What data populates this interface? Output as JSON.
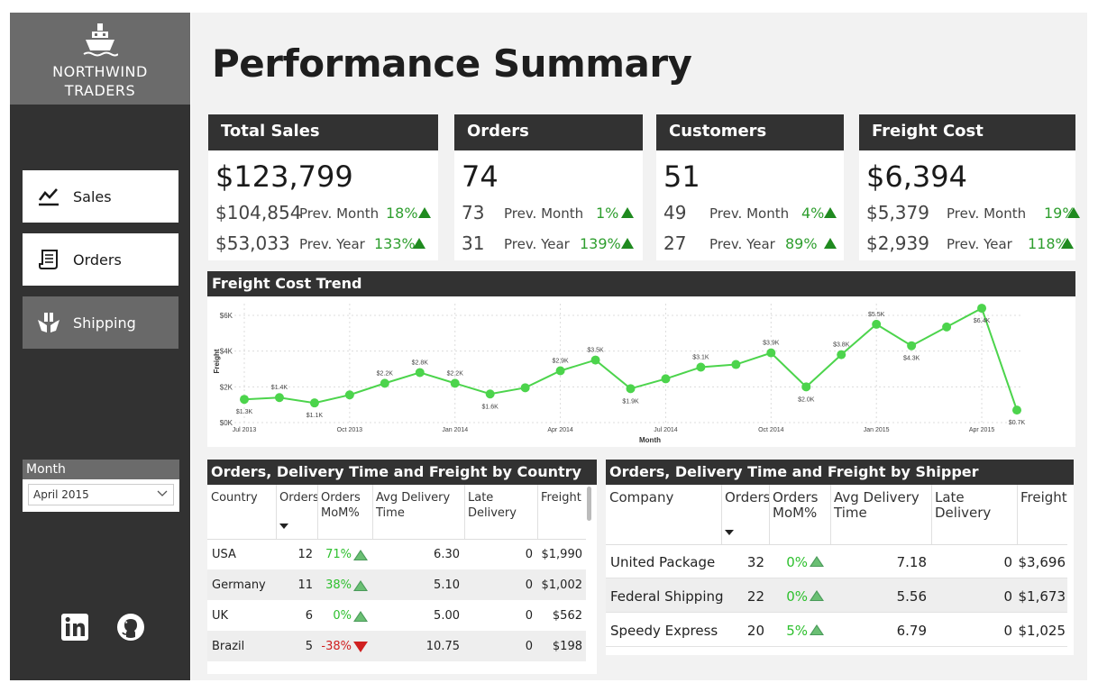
{
  "brand": {
    "line1": "NORTHWIND",
    "line2": "TRADERS"
  },
  "nav": [
    {
      "label": "Sales",
      "icon": "line-chart-icon",
      "active": false
    },
    {
      "label": "Orders",
      "icon": "receipt-icon",
      "active": false
    },
    {
      "label": "Shipping",
      "icon": "box-hands-icon",
      "active": true
    }
  ],
  "month_slicer": {
    "label": "Month",
    "selected": "April 2015"
  },
  "social": [
    {
      "icon": "linkedin-icon"
    },
    {
      "icon": "github-icon"
    }
  ],
  "page_title": "Performance Summary",
  "kpis": [
    {
      "title": "Total Sales",
      "value": "$123,799",
      "prev_month_value": "$104,854",
      "prev_month_label": "Prev. Month",
      "prev_month_pct": "18%",
      "prev_year_value": "$53,033",
      "prev_year_label": "Prev. Year",
      "prev_year_pct": "133%"
    },
    {
      "title": "Orders",
      "value": "74",
      "prev_month_value": "73",
      "prev_month_label": "Prev. Month",
      "prev_month_pct": "1%",
      "prev_year_value": "31",
      "prev_year_label": "Prev. Year",
      "prev_year_pct": "139%"
    },
    {
      "title": "Customers",
      "value": "51",
      "prev_month_value": "49",
      "prev_month_label": "Prev. Month",
      "prev_month_pct": "4%",
      "prev_year_value": "27",
      "prev_year_label": "Prev. Year",
      "prev_year_pct": "89%"
    },
    {
      "title": "Freight Cost",
      "value": "$6,394",
      "prev_month_value": "$5,379",
      "prev_month_label": "Prev. Month",
      "prev_month_pct": "19%",
      "prev_year_value": "$2,939",
      "prev_year_label": "Prev. Year",
      "prev_year_pct": "118%"
    }
  ],
  "chart_panel_title": "Freight Cost Trend",
  "chart_data": {
    "type": "line",
    "xlabel": "Month",
    "ylabel": "Freight",
    "ylim": [
      0,
      6500
    ],
    "y_ticks": [
      {
        "v": 0,
        "label": "$0K"
      },
      {
        "v": 2000,
        "label": "$2K"
      },
      {
        "v": 4000,
        "label": "$4K"
      },
      {
        "v": 6000,
        "label": "$6K"
      }
    ],
    "x_ticks": [
      {
        "i": 0,
        "label": "Jul 2013"
      },
      {
        "i": 3,
        "label": "Oct 2013"
      },
      {
        "i": 6,
        "label": "Jan 2014"
      },
      {
        "i": 9,
        "label": "Apr 2014"
      },
      {
        "i": 12,
        "label": "Jul 2014"
      },
      {
        "i": 15,
        "label": "Oct 2014"
      },
      {
        "i": 18,
        "label": "Jan 2015"
      },
      {
        "i": 21,
        "label": "Apr 2015"
      }
    ],
    "color": "#4cd44c",
    "months": [
      "Jul 2013",
      "Aug 2013",
      "Sep 2013",
      "Oct 2013",
      "Nov 2013",
      "Dec 2013",
      "Jan 2014",
      "Feb 2014",
      "Mar 2014",
      "Apr 2014",
      "May 2014",
      "Jun 2014",
      "Jul 2014",
      "Aug 2014",
      "Sep 2014",
      "Oct 2014",
      "Nov 2014",
      "Dec 2014",
      "Jan 2015",
      "Feb 2015",
      "Mar 2015",
      "Apr 2015",
      "May 2015"
    ],
    "values": [
      1300,
      1400,
      1100,
      1550,
      2200,
      2800,
      2200,
      1600,
      1950,
      2900,
      3500,
      1900,
      2450,
      3100,
      3250,
      3900,
      2000,
      3800,
      5500,
      4300,
      5350,
      6400,
      700
    ],
    "point_labels": [
      {
        "i": 0,
        "label": "$1.3K",
        "pos": "below"
      },
      {
        "i": 1,
        "label": "$1.4K",
        "pos": "above"
      },
      {
        "i": 2,
        "label": "$1.1K",
        "pos": "below"
      },
      {
        "i": 4,
        "label": "$2.2K",
        "pos": "above"
      },
      {
        "i": 5,
        "label": "$2.8K",
        "pos": "above"
      },
      {
        "i": 6,
        "label": "$2.2K",
        "pos": "above"
      },
      {
        "i": 7,
        "label": "$1.6K",
        "pos": "below"
      },
      {
        "i": 9,
        "label": "$2.9K",
        "pos": "above"
      },
      {
        "i": 10,
        "label": "$3.5K",
        "pos": "above"
      },
      {
        "i": 11,
        "label": "$1.9K",
        "pos": "below"
      },
      {
        "i": 13,
        "label": "$3.1K",
        "pos": "above"
      },
      {
        "i": 15,
        "label": "$3.9K",
        "pos": "above"
      },
      {
        "i": 16,
        "label": "$2.0K",
        "pos": "below"
      },
      {
        "i": 17,
        "label": "$3.8K",
        "pos": "above"
      },
      {
        "i": 18,
        "label": "$5.5K",
        "pos": "above"
      },
      {
        "i": 19,
        "label": "$4.3K",
        "pos": "below"
      },
      {
        "i": 21,
        "label": "$6.4K",
        "pos": "below"
      },
      {
        "i": 22,
        "label": "$0.7K",
        "pos": "below"
      }
    ]
  },
  "country_table": {
    "title": "Orders, Delivery Time and Freight by Country",
    "columns": [
      "Country",
      "Orders",
      "Orders MoM%",
      "Avg Delivery Time",
      "Late Delivery",
      "Freight"
    ],
    "rows": [
      {
        "country": "USA",
        "orders": "12",
        "mom": "71%",
        "trend": "up",
        "avg": "6.30",
        "late": "0",
        "freight": "$1,990"
      },
      {
        "country": "Germany",
        "orders": "11",
        "mom": "38%",
        "trend": "up",
        "avg": "5.10",
        "late": "0",
        "freight": "$1,002"
      },
      {
        "country": "UK",
        "orders": "6",
        "mom": "0%",
        "trend": "up",
        "avg": "5.00",
        "late": "0",
        "freight": "$562"
      },
      {
        "country": "Brazil",
        "orders": "5",
        "mom": "-38%",
        "trend": "down",
        "avg": "10.75",
        "late": "0",
        "freight": "$198"
      }
    ]
  },
  "shipper_table": {
    "title": "Orders, Delivery Time and Freight by Shipper",
    "columns": [
      "Company",
      "Orders",
      "Orders MoM%",
      "Avg Delivery Time",
      "Late Delivery",
      "Freight"
    ],
    "rows": [
      {
        "company": "United Package",
        "orders": "32",
        "mom": "0%",
        "trend": "up",
        "avg": "7.18",
        "late": "0",
        "freight": "$3,696"
      },
      {
        "company": "Federal Shipping",
        "orders": "22",
        "mom": "0%",
        "trend": "up",
        "avg": "5.56",
        "late": "0",
        "freight": "$1,673"
      },
      {
        "company": "Speedy Express",
        "orders": "20",
        "mom": "5%",
        "trend": "up",
        "avg": "6.79",
        "late": "0",
        "freight": "$1,025"
      }
    ]
  }
}
